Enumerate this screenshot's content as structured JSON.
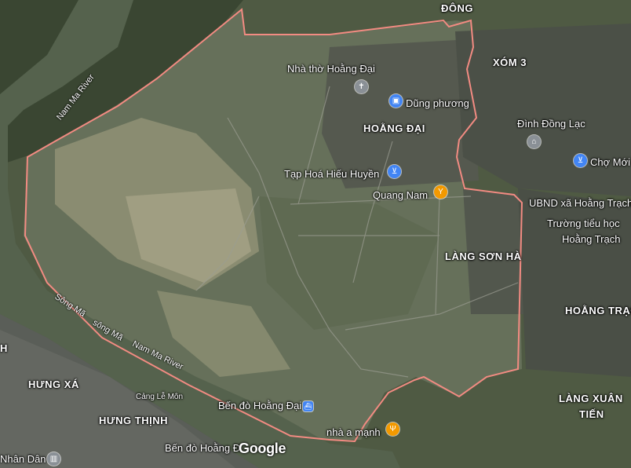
{
  "map": {
    "colors": {
      "boundary": "#f28b82",
      "river": "#55624d",
      "fields": "#6b7a5a",
      "village": "#4a4f4a"
    },
    "area_labels": {
      "dong": "ĐÔNG",
      "xom3": "XÓM 3",
      "hoang_dai": "HOẰNG ĐẠI",
      "lang_son_ha": "LÀNG SƠN HÀ",
      "hoang_trac": "HOẰNG TRẠC",
      "lang_xuan_tien_1": "LÀNG XUÂN",
      "lang_xuan_tien_2": "TIẾN",
      "hung_xa": "HƯNG XÁ",
      "hung_thinh": "HƯNG THỊNH"
    },
    "places": {
      "church": "Nhà thờ Hoằng Đại",
      "dung_phuong": "Dũng phương",
      "dinh_dong_lac": "Đình Đồng Lạc",
      "cho_moi": "Chợ Mới",
      "tap_hoa": "Tạp Hoá Hiếu Huyền",
      "quang_nam": "Quang Nam",
      "ubnd": "UBND xã Hoằng Trạch",
      "truong_1": "Trường tiểu học",
      "truong_2": "Hoằng Trạch",
      "ben_do_1": "Bến đò Hoằng Đại",
      "ben_do_2": "Bến đò Hoằng Đ",
      "nha_a_manh": "nhà a mạnh",
      "cang": "Cảng Lễ Môn",
      "nhan_dan": "Nhân Dân",
      "h_left": "H"
    },
    "rivers": {
      "nam_ma_1": "Nam Ma River",
      "song_ma_1": "Sông Mã",
      "song_ma_2": "sông Mã",
      "nam_ma_2": "Nam Ma River"
    },
    "icons": {
      "church": "church-icon",
      "shop": "shopping-bag-icon",
      "temple": "temple-icon",
      "cart": "shopping-cart-icon",
      "bar": "cocktail-icon",
      "food": "restaurant-icon",
      "ferry": "ferry-icon"
    },
    "attribution": "Google"
  }
}
